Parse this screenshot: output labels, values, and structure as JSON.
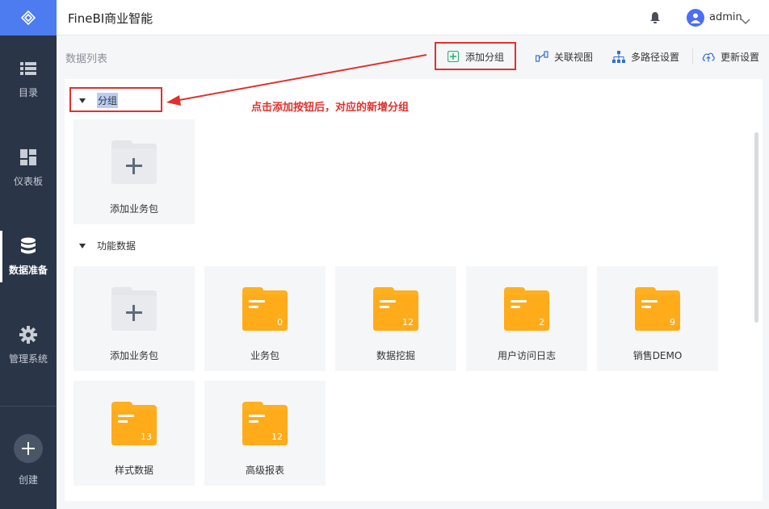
{
  "app": {
    "title": "FineBI商业智能"
  },
  "user": {
    "name": "admin"
  },
  "sidebar": {
    "items": [
      {
        "label": "目录",
        "icon": "list-icon"
      },
      {
        "label": "仪表板",
        "icon": "dashboard-icon"
      },
      {
        "label": "数据准备",
        "icon": "database-icon",
        "active": true
      },
      {
        "label": "管理系统",
        "icon": "gear-icon"
      }
    ],
    "create_label": "创建"
  },
  "toolbar": {
    "page_label": "数据列表",
    "add_group": "添加分组",
    "relation_view": "关联视图",
    "multi_path": "多路径设置",
    "update_settings": "更新设置"
  },
  "annotation": {
    "text": "点击添加按钮后，对应的新增分组"
  },
  "groups": [
    {
      "name": "分组",
      "cards": [
        {
          "label": "添加业务包",
          "type": "add"
        }
      ]
    },
    {
      "name": "功能数据",
      "cards": [
        {
          "label": "添加业务包",
          "type": "add"
        },
        {
          "label": "业务包",
          "count": "0"
        },
        {
          "label": "数据挖掘",
          "count": "12"
        },
        {
          "label": "用户访问日志",
          "count": "2"
        },
        {
          "label": "销售DEMO",
          "count": "9"
        },
        {
          "label": "样式数据",
          "count": "13"
        },
        {
          "label": "高级报表",
          "count": "12"
        }
      ]
    }
  ],
  "colors": {
    "accent": "#4c7cf0",
    "sidebar": "#2a3548",
    "folder": "#ffab1a",
    "annotation": "#e0312d"
  }
}
